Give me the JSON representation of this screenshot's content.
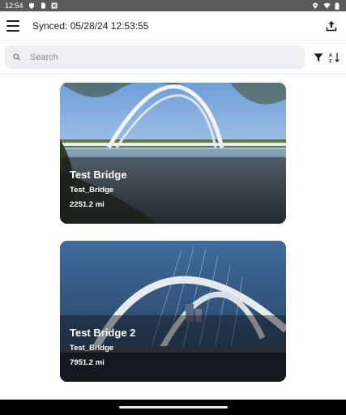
{
  "status_bar": {
    "time": "12:54",
    "left_icons": [
      "shield-icon",
      "sim-icon",
      "blocked-icon"
    ],
    "right_icons": [
      "location-icon",
      "wifi-icon",
      "battery-icon"
    ]
  },
  "app_bar": {
    "sync_text": "Synced: 05/28/24 12:53:55",
    "menu_icon": "hamburger-menu-icon",
    "upload_icon": "upload-icon"
  },
  "search": {
    "placeholder": "Search",
    "value": "",
    "filter_icon": "filter-icon",
    "sort_icon": "sort-az-icon"
  },
  "bridges": [
    {
      "title": "Test Bridge",
      "subtitle": "Test_Bridge",
      "distance": "2251.2 mi"
    },
    {
      "title": "Test Bridge 2",
      "subtitle": "Test_Bridge",
      "distance": "7951.2 mi"
    }
  ],
  "colors": {
    "status_bar_bg": "#5a5a5a",
    "search_bg": "#eeeff2",
    "overlay": "rgba(20,20,20,0.45)"
  }
}
